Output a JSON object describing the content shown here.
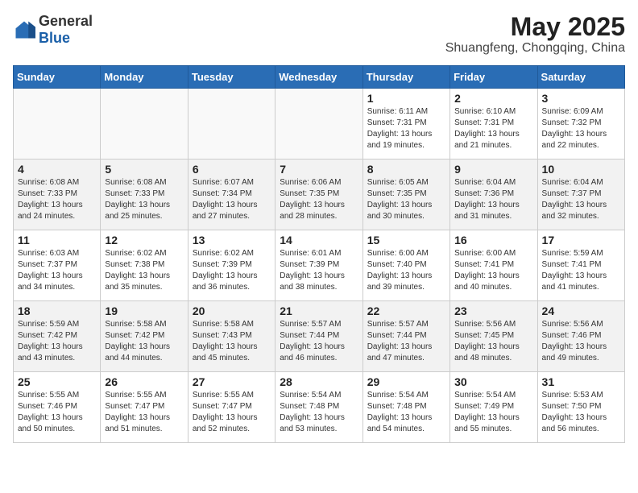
{
  "header": {
    "logo_general": "General",
    "logo_blue": "Blue",
    "month_year": "May 2025",
    "location": "Shuangfeng, Chongqing, China"
  },
  "weekdays": [
    "Sunday",
    "Monday",
    "Tuesday",
    "Wednesday",
    "Thursday",
    "Friday",
    "Saturday"
  ],
  "weeks": [
    [
      {
        "day": "",
        "info": ""
      },
      {
        "day": "",
        "info": ""
      },
      {
        "day": "",
        "info": ""
      },
      {
        "day": "",
        "info": ""
      },
      {
        "day": "1",
        "info": "Sunrise: 6:11 AM\nSunset: 7:31 PM\nDaylight: 13 hours\nand 19 minutes."
      },
      {
        "day": "2",
        "info": "Sunrise: 6:10 AM\nSunset: 7:31 PM\nDaylight: 13 hours\nand 21 minutes."
      },
      {
        "day": "3",
        "info": "Sunrise: 6:09 AM\nSunset: 7:32 PM\nDaylight: 13 hours\nand 22 minutes."
      }
    ],
    [
      {
        "day": "4",
        "info": "Sunrise: 6:08 AM\nSunset: 7:33 PM\nDaylight: 13 hours\nand 24 minutes."
      },
      {
        "day": "5",
        "info": "Sunrise: 6:08 AM\nSunset: 7:33 PM\nDaylight: 13 hours\nand 25 minutes."
      },
      {
        "day": "6",
        "info": "Sunrise: 6:07 AM\nSunset: 7:34 PM\nDaylight: 13 hours\nand 27 minutes."
      },
      {
        "day": "7",
        "info": "Sunrise: 6:06 AM\nSunset: 7:35 PM\nDaylight: 13 hours\nand 28 minutes."
      },
      {
        "day": "8",
        "info": "Sunrise: 6:05 AM\nSunset: 7:35 PM\nDaylight: 13 hours\nand 30 minutes."
      },
      {
        "day": "9",
        "info": "Sunrise: 6:04 AM\nSunset: 7:36 PM\nDaylight: 13 hours\nand 31 minutes."
      },
      {
        "day": "10",
        "info": "Sunrise: 6:04 AM\nSunset: 7:37 PM\nDaylight: 13 hours\nand 32 minutes."
      }
    ],
    [
      {
        "day": "11",
        "info": "Sunrise: 6:03 AM\nSunset: 7:37 PM\nDaylight: 13 hours\nand 34 minutes."
      },
      {
        "day": "12",
        "info": "Sunrise: 6:02 AM\nSunset: 7:38 PM\nDaylight: 13 hours\nand 35 minutes."
      },
      {
        "day": "13",
        "info": "Sunrise: 6:02 AM\nSunset: 7:39 PM\nDaylight: 13 hours\nand 36 minutes."
      },
      {
        "day": "14",
        "info": "Sunrise: 6:01 AM\nSunset: 7:39 PM\nDaylight: 13 hours\nand 38 minutes."
      },
      {
        "day": "15",
        "info": "Sunrise: 6:00 AM\nSunset: 7:40 PM\nDaylight: 13 hours\nand 39 minutes."
      },
      {
        "day": "16",
        "info": "Sunrise: 6:00 AM\nSunset: 7:41 PM\nDaylight: 13 hours\nand 40 minutes."
      },
      {
        "day": "17",
        "info": "Sunrise: 5:59 AM\nSunset: 7:41 PM\nDaylight: 13 hours\nand 41 minutes."
      }
    ],
    [
      {
        "day": "18",
        "info": "Sunrise: 5:59 AM\nSunset: 7:42 PM\nDaylight: 13 hours\nand 43 minutes."
      },
      {
        "day": "19",
        "info": "Sunrise: 5:58 AM\nSunset: 7:42 PM\nDaylight: 13 hours\nand 44 minutes."
      },
      {
        "day": "20",
        "info": "Sunrise: 5:58 AM\nSunset: 7:43 PM\nDaylight: 13 hours\nand 45 minutes."
      },
      {
        "day": "21",
        "info": "Sunrise: 5:57 AM\nSunset: 7:44 PM\nDaylight: 13 hours\nand 46 minutes."
      },
      {
        "day": "22",
        "info": "Sunrise: 5:57 AM\nSunset: 7:44 PM\nDaylight: 13 hours\nand 47 minutes."
      },
      {
        "day": "23",
        "info": "Sunrise: 5:56 AM\nSunset: 7:45 PM\nDaylight: 13 hours\nand 48 minutes."
      },
      {
        "day": "24",
        "info": "Sunrise: 5:56 AM\nSunset: 7:46 PM\nDaylight: 13 hours\nand 49 minutes."
      }
    ],
    [
      {
        "day": "25",
        "info": "Sunrise: 5:55 AM\nSunset: 7:46 PM\nDaylight: 13 hours\nand 50 minutes."
      },
      {
        "day": "26",
        "info": "Sunrise: 5:55 AM\nSunset: 7:47 PM\nDaylight: 13 hours\nand 51 minutes."
      },
      {
        "day": "27",
        "info": "Sunrise: 5:55 AM\nSunset: 7:47 PM\nDaylight: 13 hours\nand 52 minutes."
      },
      {
        "day": "28",
        "info": "Sunrise: 5:54 AM\nSunset: 7:48 PM\nDaylight: 13 hours\nand 53 minutes."
      },
      {
        "day": "29",
        "info": "Sunrise: 5:54 AM\nSunset: 7:48 PM\nDaylight: 13 hours\nand 54 minutes."
      },
      {
        "day": "30",
        "info": "Sunrise: 5:54 AM\nSunset: 7:49 PM\nDaylight: 13 hours\nand 55 minutes."
      },
      {
        "day": "31",
        "info": "Sunrise: 5:53 AM\nSunset: 7:50 PM\nDaylight: 13 hours\nand 56 minutes."
      }
    ]
  ]
}
